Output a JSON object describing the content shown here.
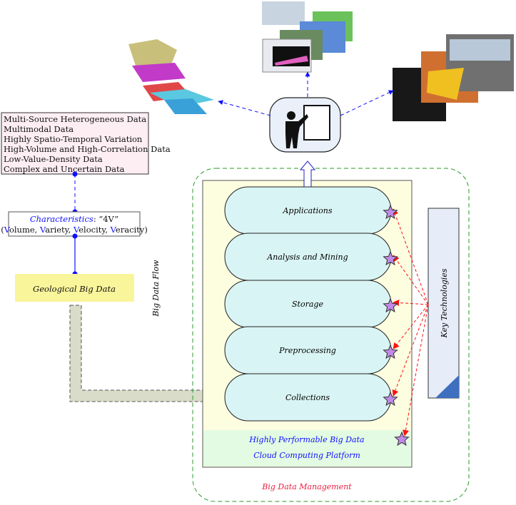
{
  "properties": [
    "Multi-Source Heterogeneous Data",
    "Multimodal Data",
    "Highly Spatio-Temporal Variation",
    "High-Volume and High-Correlation Data",
    "Low-Value-Density Data",
    "Complex and Uncertain Data"
  ],
  "characteristics": {
    "label": "Characteristics",
    "suffix": ": “4V”",
    "v_words": [
      "olume",
      "ariety",
      "elocity",
      "eracity"
    ],
    "v_letter": "V"
  },
  "geo_label": "Geological Big Data",
  "flow_label": "Big Data Flow",
  "layers": [
    "Applications",
    "Analysis and Mining",
    "Storage",
    "Preprocessing",
    "Collections"
  ],
  "platform": {
    "line1": "Highly Performable Big Data",
    "line2": "Cloud Computing Platform"
  },
  "key_tech": "Key Technologies",
  "management": "Big Data Management",
  "colors": {
    "pink": "#fdeef4",
    "yellow": "#f9f59a",
    "panel": "#fdfde0",
    "pill": "#d9f4f4",
    "green": "#e2fbe2",
    "blue": "#1010ff",
    "red": "#ff1010",
    "star": "#c08ae8",
    "keybox": "#e6ecf8"
  }
}
